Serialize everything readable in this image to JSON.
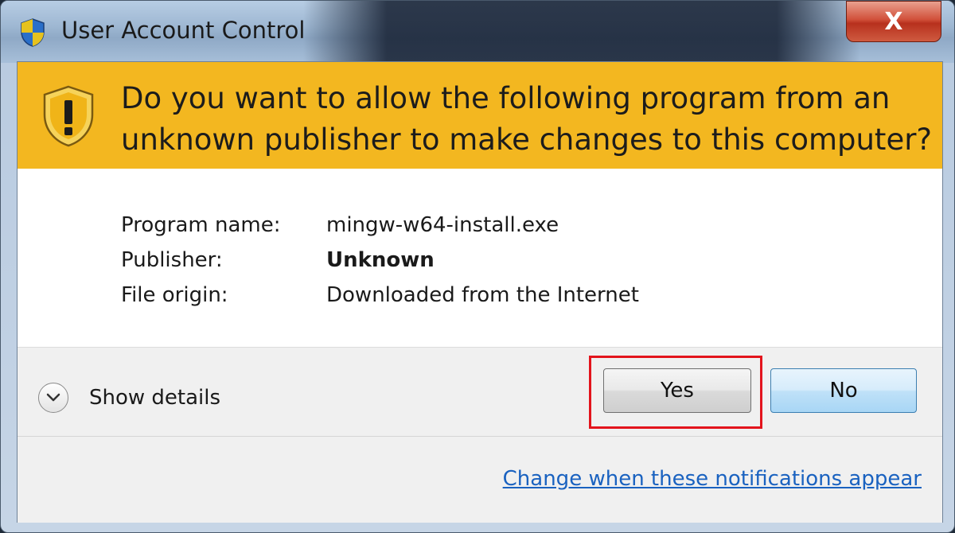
{
  "window": {
    "title": "User Account Control",
    "close_label": "X"
  },
  "banner": {
    "question": "Do you want to allow the following program from an unknown publisher to make changes to this computer?"
  },
  "info": {
    "rows": [
      {
        "label": "Program name:",
        "value": "mingw-w64-install.exe",
        "bold": false
      },
      {
        "label": "Publisher:",
        "value": "Unknown",
        "bold": true
      },
      {
        "label": "File origin:",
        "value": "Downloaded from the Internet",
        "bold": false
      }
    ]
  },
  "footer": {
    "show_details": "Show details",
    "yes_label": "Yes",
    "no_label": "No",
    "link": "Change when these notifications appear"
  },
  "colors": {
    "banner": "#f3b720",
    "highlight": "#e3141c",
    "link": "#1a62c0"
  },
  "icons": [
    "uac-shield-icon",
    "warning-shield-icon",
    "chevron-down-icon",
    "close-icon"
  ]
}
